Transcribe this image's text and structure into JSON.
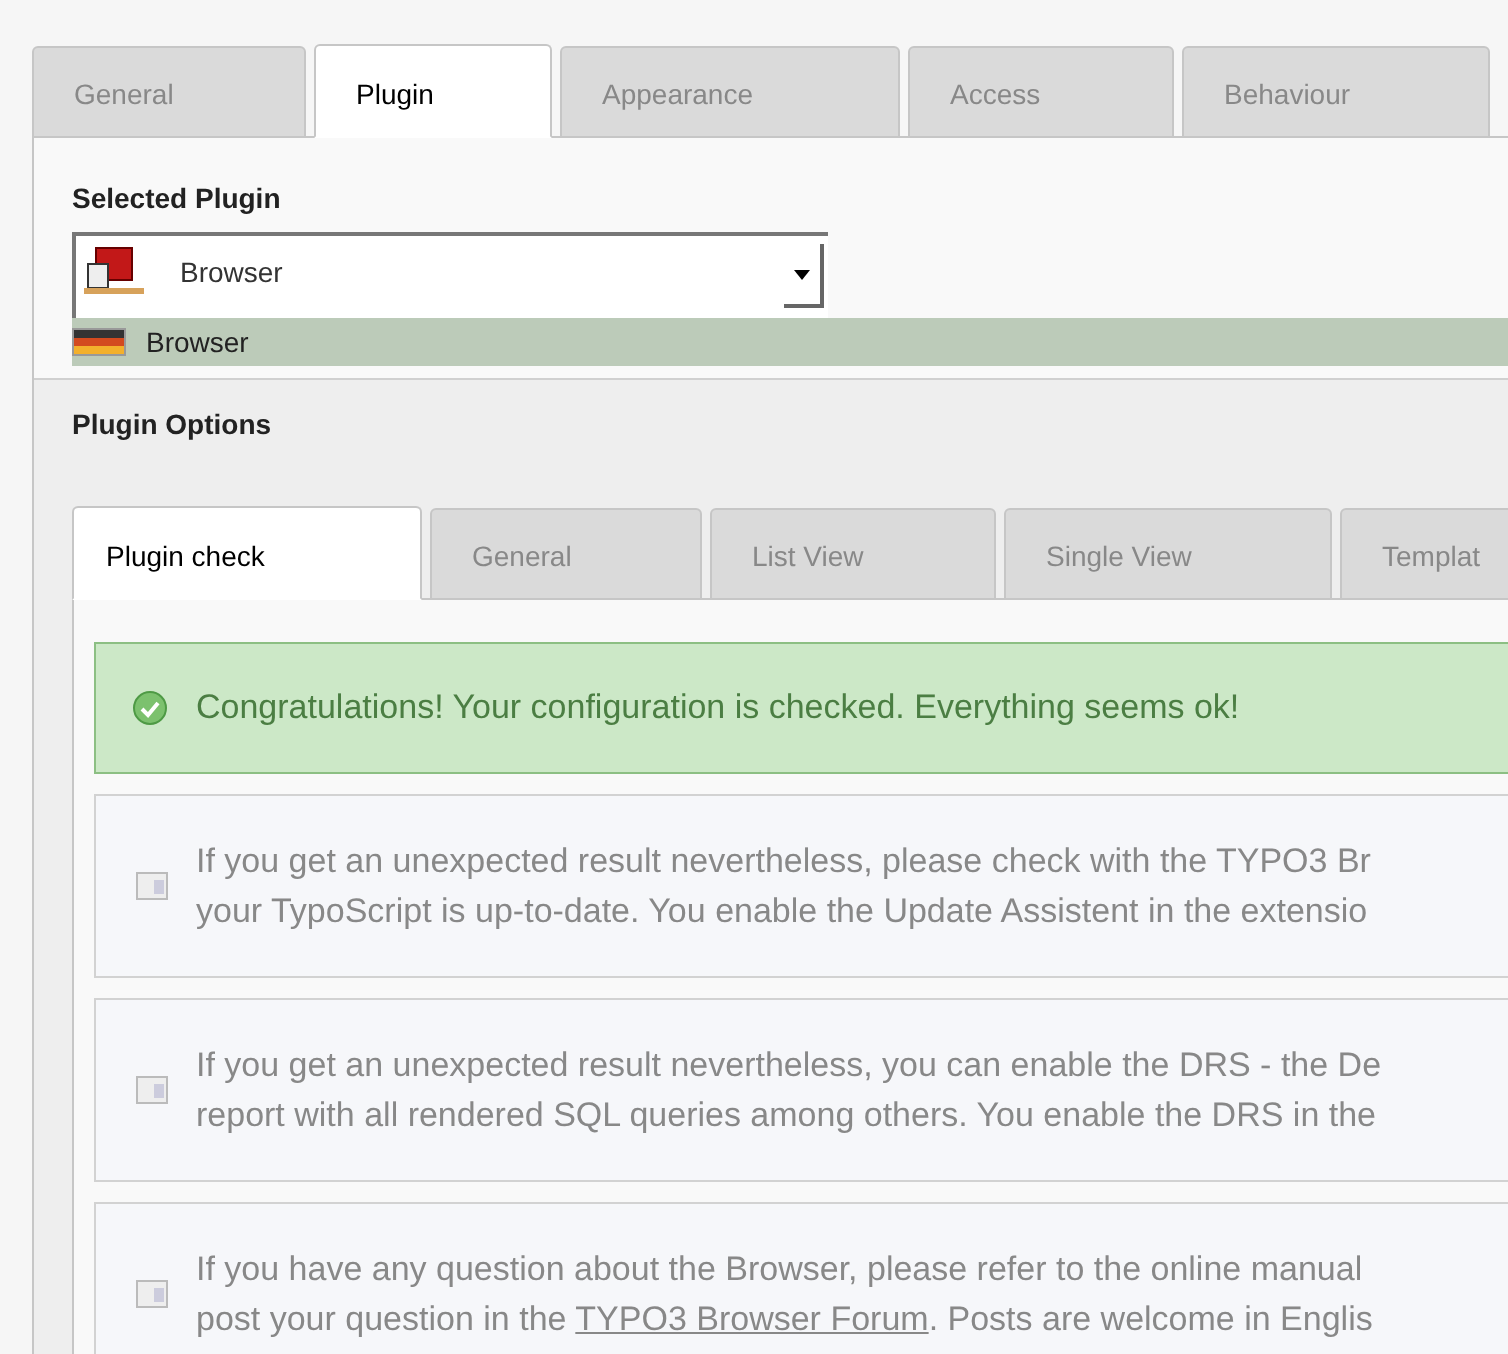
{
  "tabs": [
    {
      "label": "General",
      "selected": false
    },
    {
      "label": "Plugin",
      "selected": true
    },
    {
      "label": "Appearance",
      "selected": false
    },
    {
      "label": "Access",
      "selected": false
    },
    {
      "label": "Behaviour",
      "selected": false
    }
  ],
  "selected_plugin": {
    "label": "Selected Plugin",
    "value": "Browser",
    "option": "Browser"
  },
  "plugin_options": {
    "label": "Plugin Options",
    "tabs": [
      {
        "label": "Plugin check",
        "selected": true
      },
      {
        "label": "General",
        "selected": false
      },
      {
        "label": "List View",
        "selected": false
      },
      {
        "label": "Single View",
        "selected": false
      },
      {
        "label": "Templat",
        "selected": false
      }
    ],
    "messages": [
      {
        "kind": "success",
        "lines": [
          [
            {
              "text": "Congratulations! Your configuration is checked. Everything seems ok!"
            }
          ]
        ]
      },
      {
        "kind": "info",
        "lines": [
          [
            {
              "text": "If you get an unexpected result nevertheless, please check with the TYPO3 Br"
            }
          ],
          [
            {
              "text": "your TypoScript is up-to-date. You enable the Update Assistent in the extensio"
            }
          ]
        ]
      },
      {
        "kind": "info",
        "lines": [
          [
            {
              "text": "If you get an unexpected result nevertheless, you can enable the DRS - the De"
            }
          ],
          [
            {
              "text": "report with all rendered SQL queries among others. You enable the DRS in the"
            }
          ]
        ]
      },
      {
        "kind": "info",
        "lines": [
          [
            {
              "text": "If you have any question about the Browser, please refer to the online manual"
            }
          ],
          [
            {
              "text": "post your question in the "
            },
            {
              "text": "TYPO3 Browser Forum",
              "link": true
            },
            {
              "text": ". Posts are welcome in Englis"
            }
          ]
        ]
      }
    ]
  }
}
